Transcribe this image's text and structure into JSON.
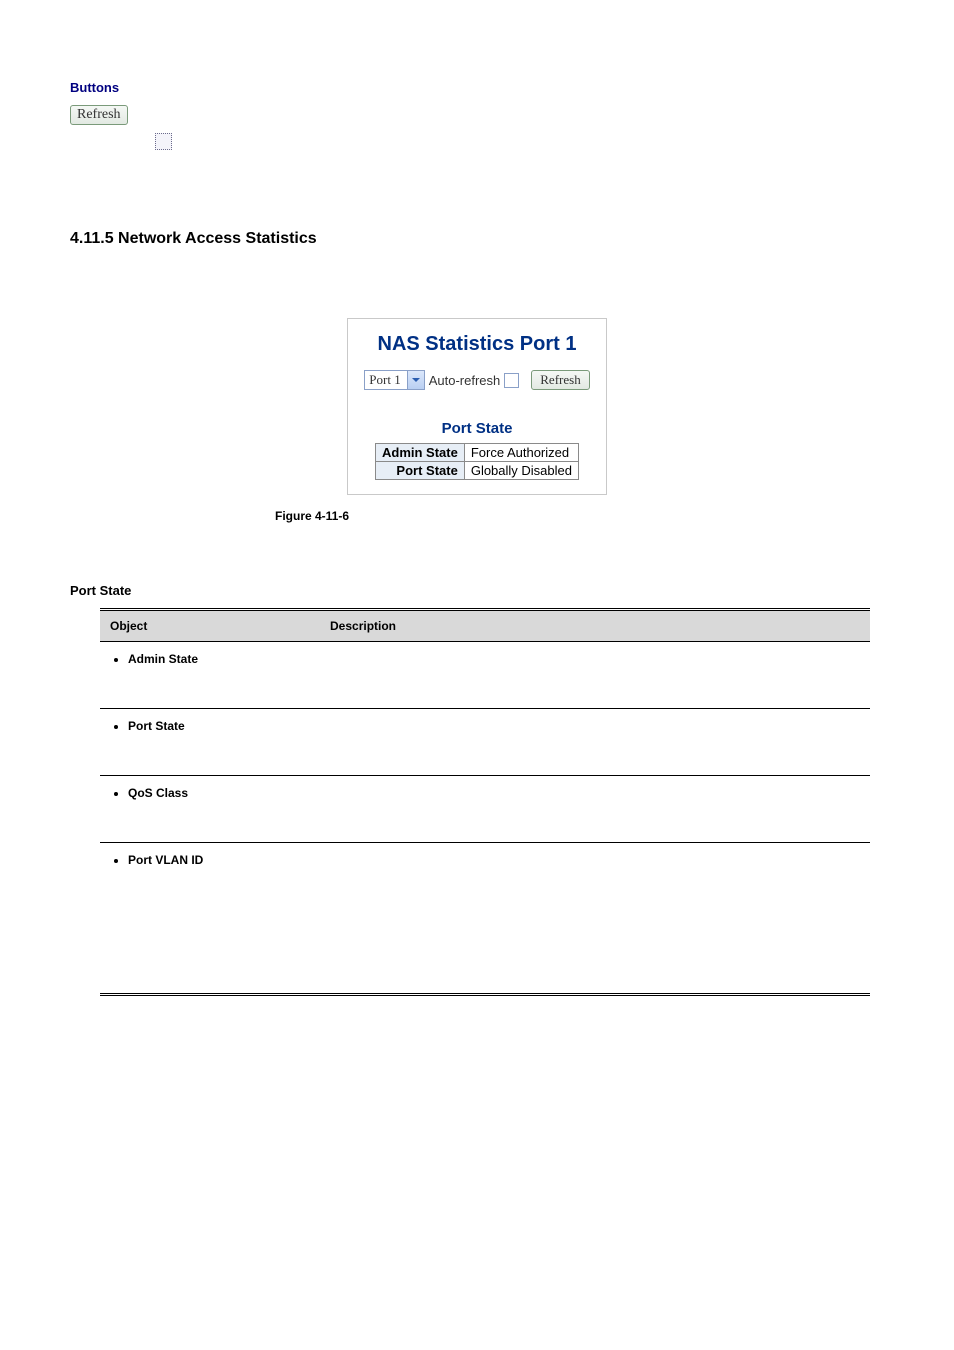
{
  "header": {
    "buttons_label": "Buttons",
    "refresh_label": "Refresh"
  },
  "section": {
    "number_title": "4.11.5 Network Access Statistics"
  },
  "figure": {
    "title": "NAS Statistics  Port 1",
    "port_select_value": "Port 1",
    "auto_refresh_label": "Auto-refresh",
    "refresh_label": "Refresh",
    "subheading": "Port State",
    "rows": [
      {
        "label": "Admin State",
        "value": "Force Authorized"
      },
      {
        "label": "Port State",
        "value": "Globally Disabled"
      }
    ],
    "caption": "Figure 4-11-6"
  },
  "port_state_section": {
    "heading": "Port State",
    "columns": {
      "object": "Object",
      "description": "Description"
    },
    "items": [
      {
        "label": "Admin State"
      },
      {
        "label": "Port State"
      },
      {
        "label": "QoS Class"
      },
      {
        "label": "Port VLAN ID"
      }
    ]
  }
}
